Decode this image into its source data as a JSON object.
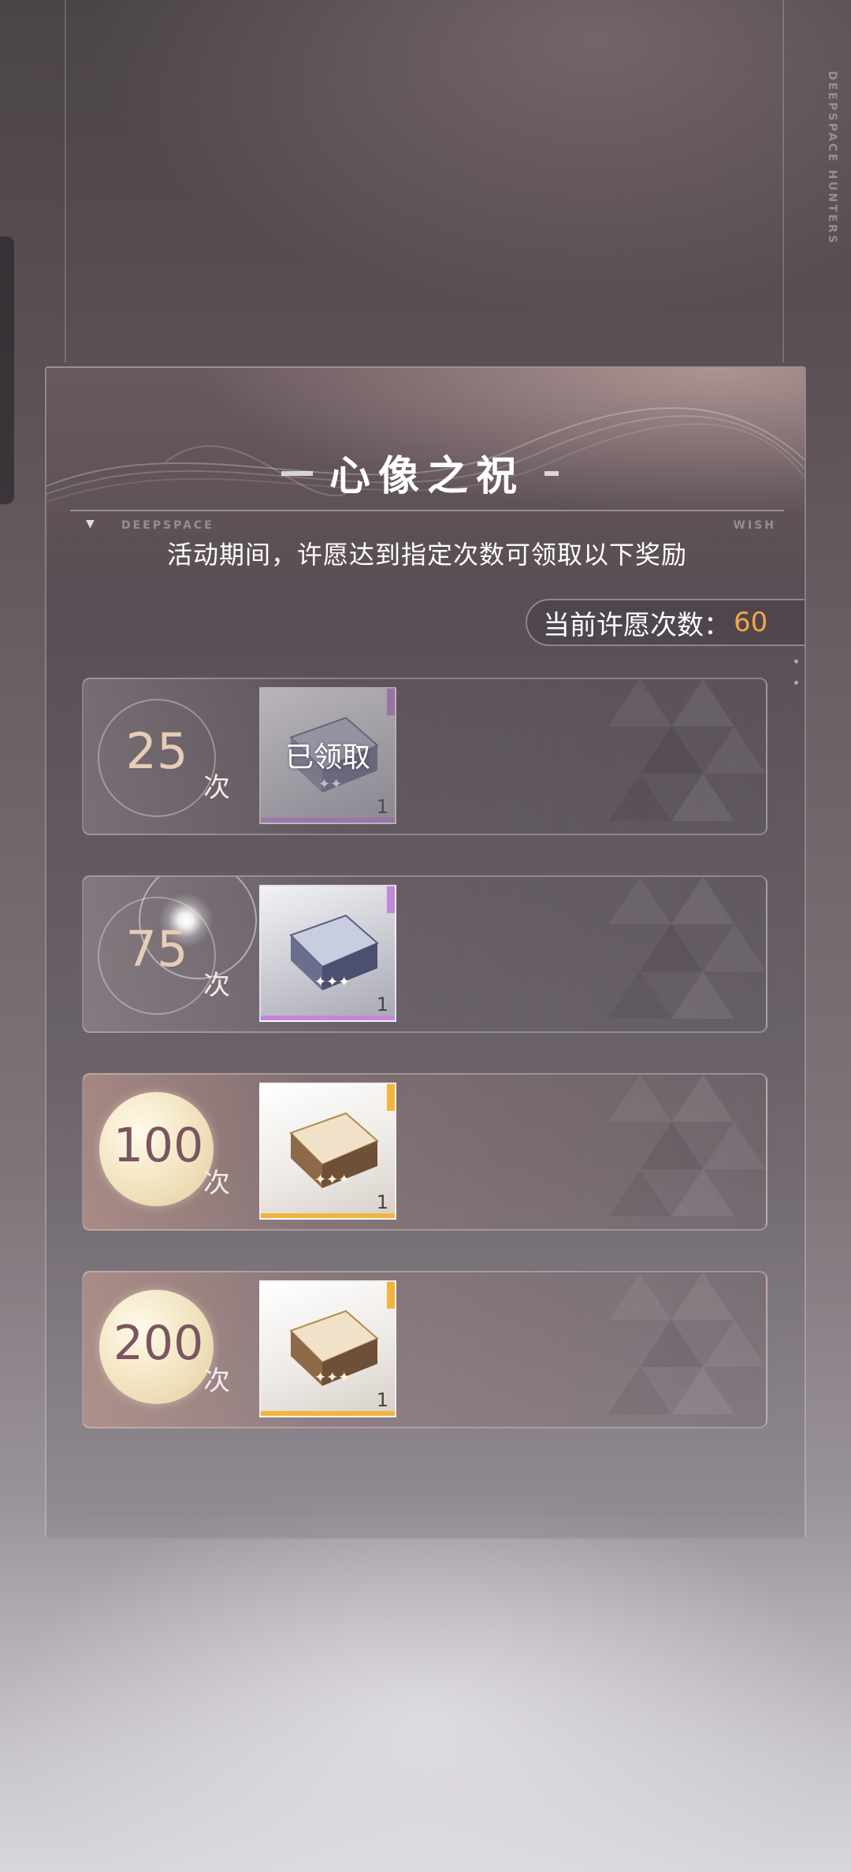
{
  "brand": {
    "vertical_text": "DEEPSPACE HUNTERS"
  },
  "panel": {
    "title": "心像之祝",
    "rule_left": "DEEPSPACE",
    "rule_right": "WISH",
    "subtitle": "活动期间，许愿达到指定次数可领取以下奖励",
    "counter_label": "当前许愿次数：",
    "counter_value": "60"
  },
  "milestones": [
    {
      "count": "25",
      "suffix": "次",
      "reward_qty": "1",
      "claimed_label": "已领取",
      "status": "claimed",
      "rarity": "purple"
    },
    {
      "count": "75",
      "suffix": "次",
      "reward_qty": "1",
      "status": "locked",
      "rarity": "purple"
    },
    {
      "count": "100",
      "suffix": "次",
      "reward_qty": "1",
      "status": "locked",
      "rarity": "gold"
    },
    {
      "count": "200",
      "suffix": "次",
      "reward_qty": "1",
      "status": "locked",
      "rarity": "gold"
    }
  ],
  "colors": {
    "accent_orange": "#f2a64a",
    "rarity_purple": "#c288d8",
    "rarity_gold": "#f2b43c"
  },
  "icons": {
    "reward_purple": "purple-wish-box-icon",
    "reward_gold": "gold-wish-box-icon"
  }
}
